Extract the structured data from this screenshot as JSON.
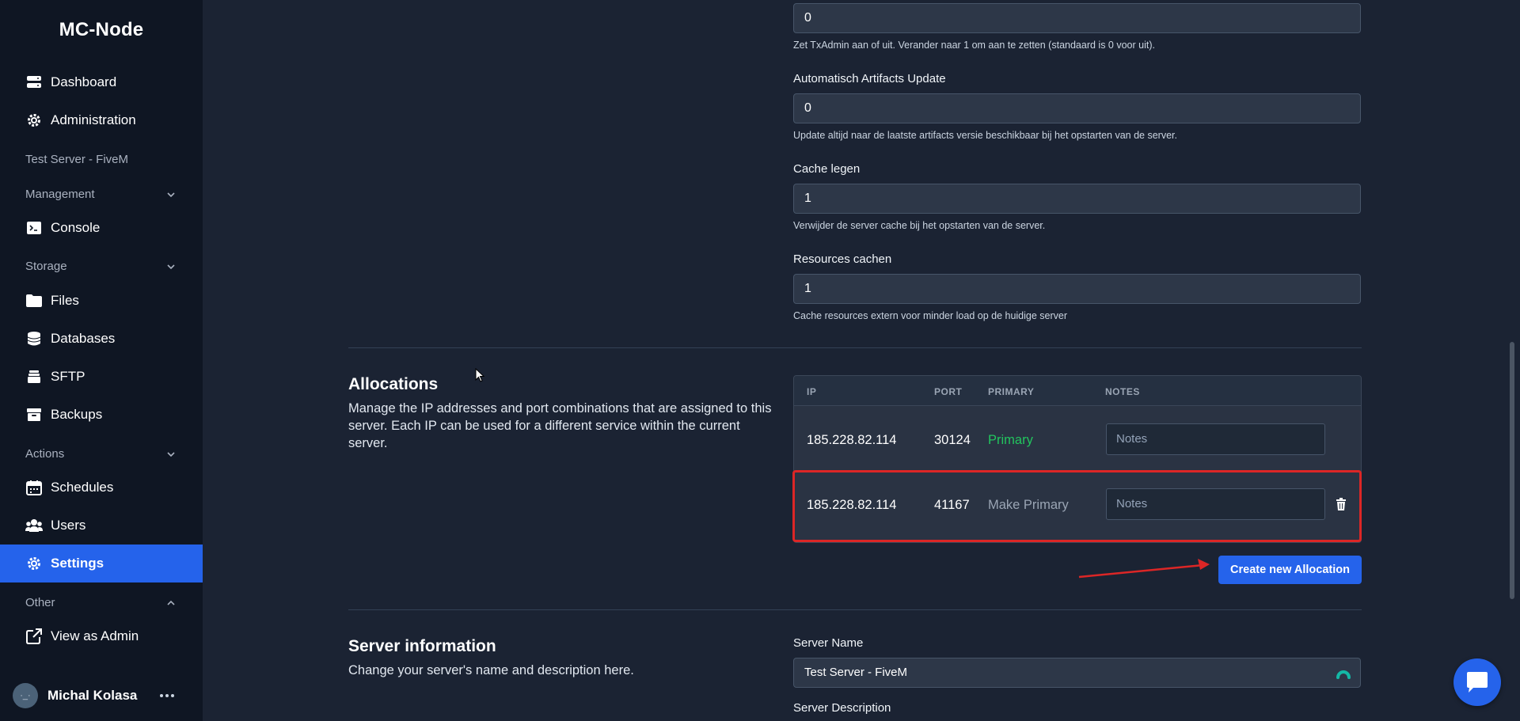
{
  "sidebar": {
    "brand": "MC-Node",
    "dashboard": "Dashboard",
    "administration": "Administration",
    "server_label": "Test Server - FiveM",
    "management": "Management",
    "console": "Console",
    "storage": "Storage",
    "files": "Files",
    "databases": "Databases",
    "sftp": "SFTP",
    "backups": "Backups",
    "actions": "Actions",
    "schedules": "Schedules",
    "users": "Users",
    "settings": "Settings",
    "other": "Other",
    "view_as_admin": "View as Admin",
    "user_name": "Michal Kolasa",
    "avatar_text": "·_·"
  },
  "fields": {
    "txadmin_value": "0",
    "txadmin_help": "Zet TxAdmin aan of uit. Verander naar 1 om aan te zetten (standaard is 0 voor uit).",
    "artifacts_label": "Automatisch Artifacts Update",
    "artifacts_value": "0",
    "artifacts_help": "Update altijd naar de laatste artifacts versie beschikbaar bij het opstarten van de server.",
    "cache_label": "Cache legen",
    "cache_value": "1",
    "cache_help": "Verwijder de server cache bij het opstarten van de server.",
    "resources_label": "Resources cachen",
    "resources_value": "1",
    "resources_help": "Cache resources extern voor minder load op de huidige server"
  },
  "allocations": {
    "title": "Allocations",
    "description": "Manage the IP addresses and port combinations that are assigned to this server. Each IP can be used for a different service within the current server.",
    "headers": {
      "ip": "IP",
      "port": "PORT",
      "primary": "PRIMARY",
      "notes": "NOTES"
    },
    "rows": [
      {
        "ip": "185.228.82.114",
        "port": "30124",
        "primary": "Primary",
        "notes_placeholder": "Notes"
      },
      {
        "ip": "185.228.82.114",
        "port": "41167",
        "primary": "Make Primary",
        "notes_placeholder": "Notes"
      }
    ],
    "create_button": "Create new Allocation"
  },
  "server_info": {
    "title": "Server information",
    "description": "Change your server's name and description here.",
    "name_label": "Server Name",
    "name_value": "Test Server - FiveM",
    "description_label": "Server Description"
  },
  "colors": {
    "accent": "#2563eb",
    "primary_green": "#22c55e",
    "highlight_red": "#dc2626"
  }
}
